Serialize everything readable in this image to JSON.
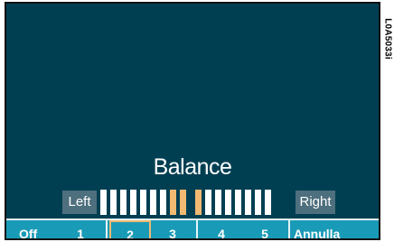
{
  "screen": {
    "title": "Balance",
    "left_label": "Left",
    "right_label": "Right",
    "balance": {
      "segments": 17,
      "highlighted_segments": [
        7,
        8,
        9
      ],
      "colors": {
        "segment": "#ffffff",
        "highlight": "#f1ba72",
        "background": "#003f52",
        "softkey_bar": "#199bb7"
      }
    }
  },
  "softkeys": [
    {
      "label": "Off",
      "selected": false
    },
    {
      "label": "1",
      "selected": false
    },
    {
      "label": "2",
      "selected": true
    },
    {
      "label": "3",
      "selected": false
    },
    {
      "label": "4",
      "selected": false
    },
    {
      "label": "5",
      "selected": false
    },
    {
      "label": "Annulla",
      "selected": false
    }
  ],
  "figure_code": "L0A5033i"
}
